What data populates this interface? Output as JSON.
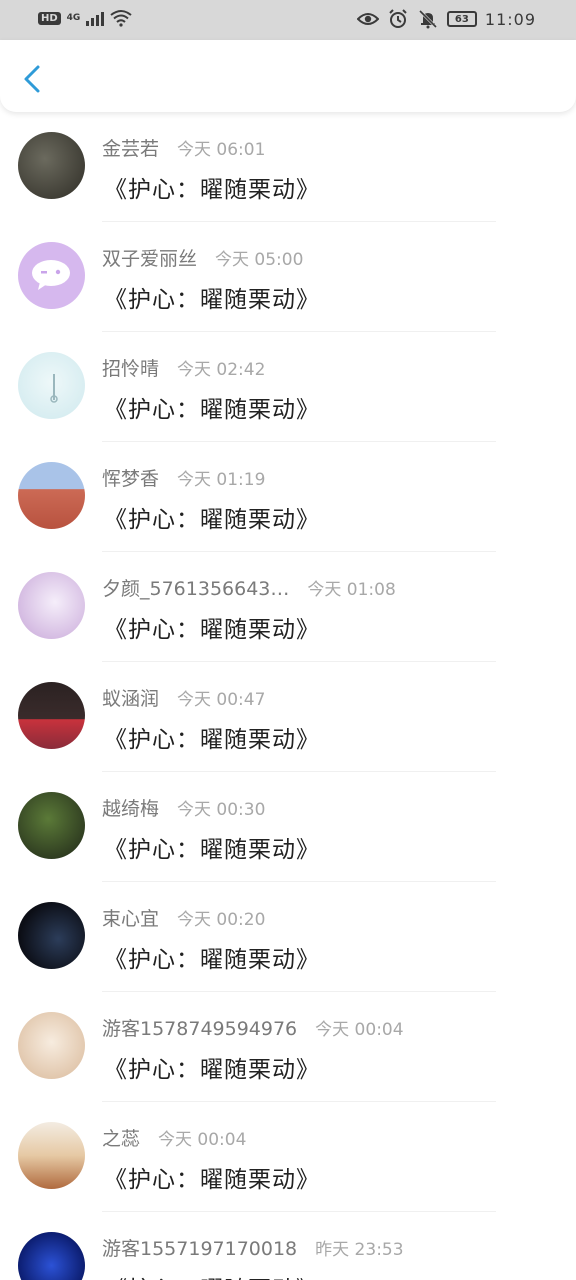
{
  "status_bar": {
    "network": "HD",
    "signal": "4G",
    "battery": "63",
    "time": "11:09",
    "icons": [
      "eye-icon",
      "alarm-icon",
      "mute-bell-icon"
    ]
  },
  "header": {
    "back_icon": "chevron-left-icon"
  },
  "messages": [
    {
      "name": "金芸若",
      "time": "今天 06:01",
      "text": "《护心：曜随栗动》",
      "avatar_colors": [
        "#6b6a5e",
        "#2f2d26"
      ]
    },
    {
      "name": "双子爱丽丝",
      "time": "今天 05:00",
      "text": "《护心：曜随栗动》",
      "avatar_colors": [
        "#d6b8ee",
        "#c9a4ea"
      ]
    },
    {
      "name": "招怜晴",
      "time": "今天 02:42",
      "text": "《护心：曜随栗动》",
      "avatar_colors": [
        "#e4f3f5",
        "#cfe9ee"
      ]
    },
    {
      "name": "恽梦香",
      "time": "今天 01:19",
      "text": "《护心：曜随栗动》",
      "avatar_colors": [
        "#cc6a55",
        "#a9c3e8"
      ]
    },
    {
      "name": "夕颜_5761356643…",
      "time": "今天 01:08",
      "text": "《护心：曜随栗动》",
      "avatar_colors": [
        "#eadcf2",
        "#c7a6d8"
      ]
    },
    {
      "name": "蚁涵润",
      "time": "今天 00:47",
      "text": "《护心：曜随栗动》",
      "avatar_colors": [
        "#2b2222",
        "#c8323c"
      ]
    },
    {
      "name": "越绮梅",
      "time": "今天 00:30",
      "text": "《护心：曜随栗动》",
      "avatar_colors": [
        "#2f3a24",
        "#5b7a38"
      ]
    },
    {
      "name": "束心宜",
      "time": "今天 00:20",
      "text": "《护心：曜随栗动》",
      "avatar_colors": [
        "#0c0e16",
        "#2c3d5a"
      ]
    },
    {
      "name": "游客1578749594976",
      "time": "今天 00:04",
      "text": "《护心：曜随栗动》",
      "avatar_colors": [
        "#f0e1d0",
        "#d9b99a"
      ]
    },
    {
      "name": "之蕊",
      "time": "今天 00:04",
      "text": "《护心：曜随栗动》",
      "avatar_colors": [
        "#f3ece2",
        "#b06a3e"
      ]
    },
    {
      "name": "游客1557197170018",
      "time": "昨天 23:53",
      "text": "《护心：曜随栗动》",
      "avatar_colors": [
        "#0a1a6a",
        "#2c52d6"
      ]
    }
  ]
}
